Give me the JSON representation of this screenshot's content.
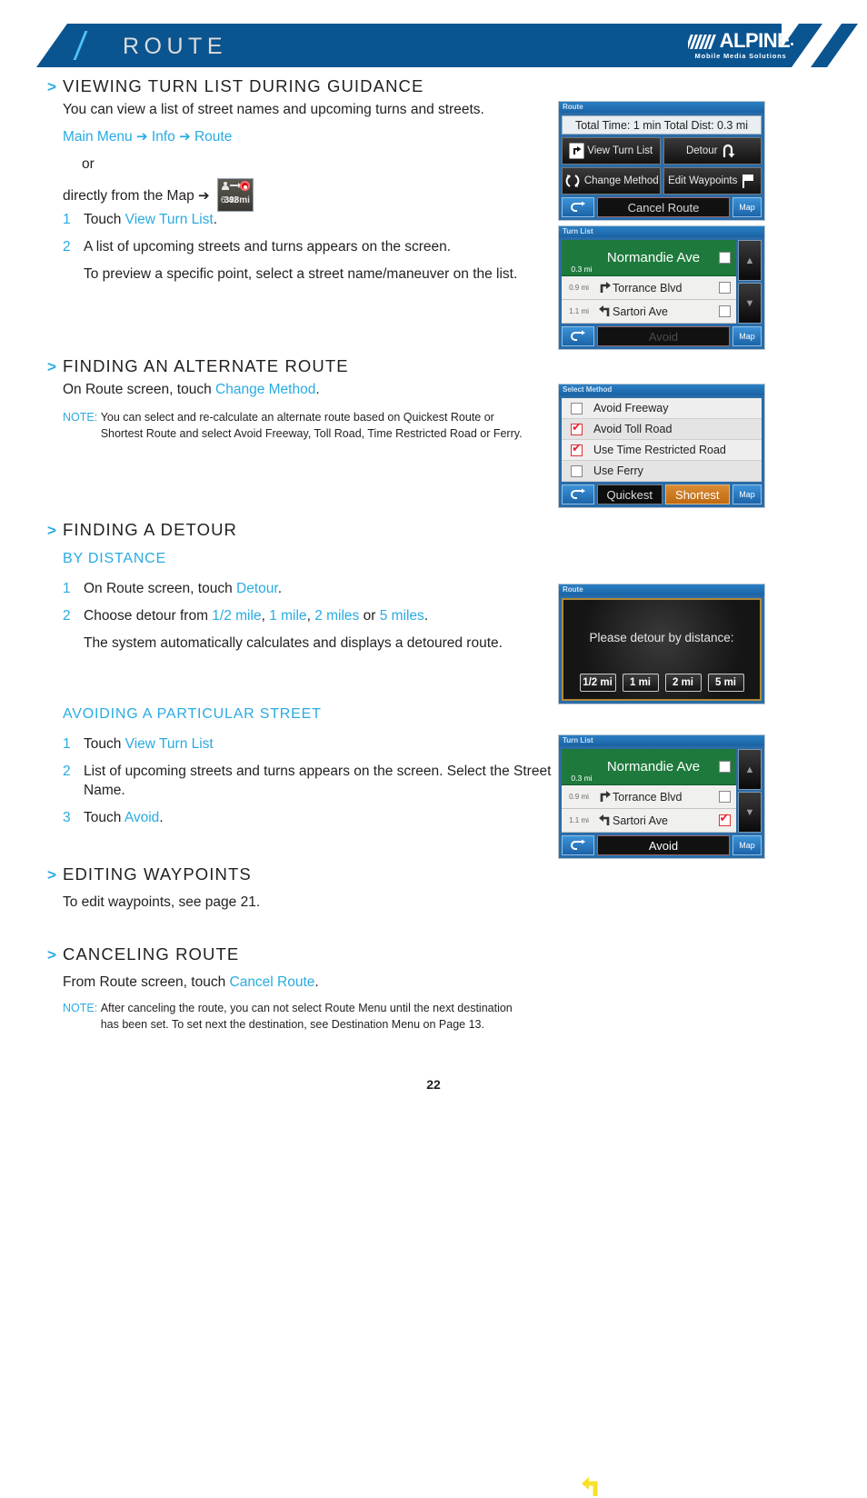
{
  "header": {
    "title": "ROUTE",
    "logo_name": "ALPINE",
    "logo_tagline": "Mobile Media Solutions"
  },
  "sections": [
    {
      "heading": "VIEWING TURN LIST DURING GUIDANCE",
      "intro": "You can view a list of street names and upcoming turns and streets.",
      "path": {
        "a": "Main Menu",
        "b": "Info",
        "c": "Route",
        "arrow": "➔"
      },
      "or": "or",
      "map_line": "directly from the Map",
      "steps": [
        {
          "num": "1",
          "pre": "Touch ",
          "link": "View Turn List",
          "post": "."
        },
        {
          "num": "2",
          "pre": "A list of upcoming streets and turns appears on the screen.",
          "link": "",
          "post": ""
        }
      ],
      "substep": "To preview a specific point, select a street name/maneuver on the list."
    },
    {
      "heading": "FINDING AN ALTERNATE ROUTE",
      "line_pre": "On Route screen, touch ",
      "line_link": "Change Method",
      "line_post": ".",
      "note_label": "NOTE:",
      "note_body": "You can select and re-calculate an alternate route based on Quickest Route or Shortest Route and select Avoid Freeway, Toll Road, Time Restricted Road or Ferry."
    },
    {
      "heading": "FINDING A DETOUR",
      "sub1": "BY DISTANCE",
      "d_step1_pre": "On Route screen, touch ",
      "d_step1_link": "Detour",
      "d_step1_post": ".",
      "d_step2_pre": "Choose detour from ",
      "d_opt1": "1/2 mile",
      "d_opt2": "1 mile",
      "d_opt3": "2 miles",
      "d_opt4": "5 miles",
      "d_or": " or ",
      "d_step3": "The system automatically calculates and displays a detoured route.",
      "sub2": "AVOIDING A PARTICULAR STREET",
      "a_step1_pre": "Touch ",
      "a_step1_link": "View Turn List",
      "a_step2": "List of upcoming streets and turns appears on the screen. Select the Street Name.",
      "a_step3_pre": "Touch ",
      "a_step3_link": "Avoid",
      "a_step3_post": "."
    },
    {
      "heading": "EDITING WAYPOINTS",
      "line": "To edit waypoints, see page 21."
    },
    {
      "heading": "CANCELING ROUTE",
      "line_pre": "From Route screen, touch ",
      "line_link": "Cancel Route",
      "line_post": ".",
      "note_label": "NOTE:",
      "note_body": "After canceling the route, you can not select Route Menu until the next destination has been set. To set next the destination, see Destination Menu on Page 13."
    }
  ],
  "map_icon": {
    "time": "6:42",
    "dist": "398mi"
  },
  "screens": {
    "route": {
      "title": "Route",
      "total": "Total Time: 1 min  Total Dist: 0.3 mi",
      "btn_view_turn_list": "View Turn List",
      "btn_detour": "Detour",
      "btn_change_method": "Change Method",
      "btn_edit_waypoints": "Edit Waypoints",
      "btn_cancel_route": "Cancel Route",
      "btn_map": "Map"
    },
    "turn_list_1": {
      "title": "Turn List",
      "rows": [
        {
          "dist": "0.3 mi",
          "name": "Normandie Ave",
          "checked": false,
          "arrow": "left"
        },
        {
          "dist": "0.9 mi",
          "name": "Torrance Blvd",
          "checked": false,
          "arrow": "right"
        },
        {
          "dist": "1.1 mi",
          "name": "Sartori Ave",
          "checked": false,
          "arrow": "left"
        }
      ],
      "btn_avoid": "Avoid",
      "btn_map": "Map",
      "avoid_active": false
    },
    "select_method": {
      "title": "Select Method",
      "rows": [
        {
          "label": "Avoid Freeway",
          "checked": false
        },
        {
          "label": "Avoid Toll Road",
          "checked": true
        },
        {
          "label": "Use Time Restricted Road",
          "checked": true
        },
        {
          "label": "Use Ferry",
          "checked": false
        }
      ],
      "btn_quickest": "Quickest",
      "btn_shortest": "Shortest",
      "btn_map": "Map"
    },
    "detour_dialog": {
      "title": "Route",
      "message": "Please detour by distance:",
      "buttons": [
        "1/2 mi",
        "1 mi",
        "2 mi",
        "5 mi"
      ]
    },
    "turn_list_2": {
      "title": "Turn List",
      "rows": [
        {
          "dist": "0.3 mi",
          "name": "Normandie Ave",
          "checked": false,
          "arrow": "left"
        },
        {
          "dist": "0.9 mi",
          "name": "Torrance Blvd",
          "checked": false,
          "arrow": "right"
        },
        {
          "dist": "1.1 mi",
          "name": "Sartori Ave",
          "checked": true,
          "arrow": "left"
        }
      ],
      "btn_avoid": "Avoid",
      "btn_map": "Map",
      "avoid_active": true
    }
  },
  "page_number": "22",
  "colors": {
    "brand_blue": "#0a5490",
    "accent_cyan": "#29abe2",
    "green_row": "#1e7a3c",
    "orange": "#c06a12",
    "check_red": "#e02222"
  }
}
